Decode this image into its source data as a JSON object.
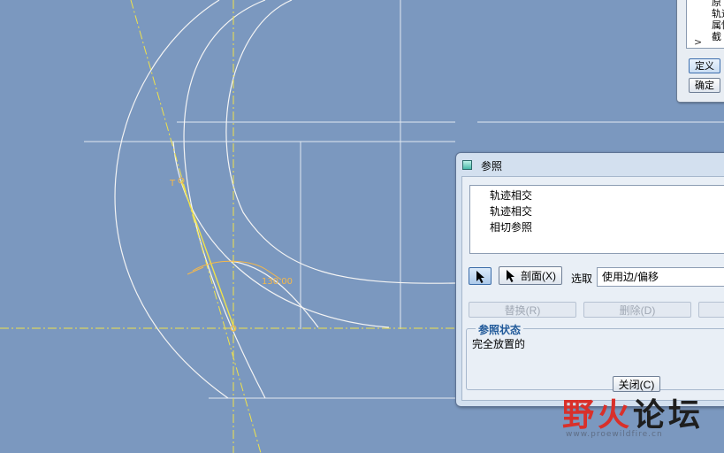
{
  "sketch": {
    "vertex_label": "T",
    "dimension_value": "130.00",
    "colors": {
      "background": "#7b98bf",
      "geometry": "#f4f4f4",
      "reference": "#f0e24a",
      "dimension": "#f5b84a"
    }
  },
  "top_panel": {
    "list_items": [
      "原",
      "轨迹",
      "属性",
      "截"
    ],
    "expand_glyph": ">",
    "define_button": "定义",
    "ok_button": "确定"
  },
  "dialog": {
    "title": "参照",
    "references": [
      "轨迹相交",
      "轨迹相交",
      "相切参照"
    ],
    "section_button": "剖面(X)",
    "select_label": "选取",
    "select_value": "使用边/偏移",
    "replace_button": "替换(R)",
    "delete_button": "删除(D)",
    "status_label": "参照状态",
    "status_value": "完全放置的",
    "close_button": "关闭(C)"
  },
  "watermark": {
    "char1": "野",
    "char2": "火",
    "char3": "论坛",
    "sub": "www.proewildfire.cn"
  }
}
